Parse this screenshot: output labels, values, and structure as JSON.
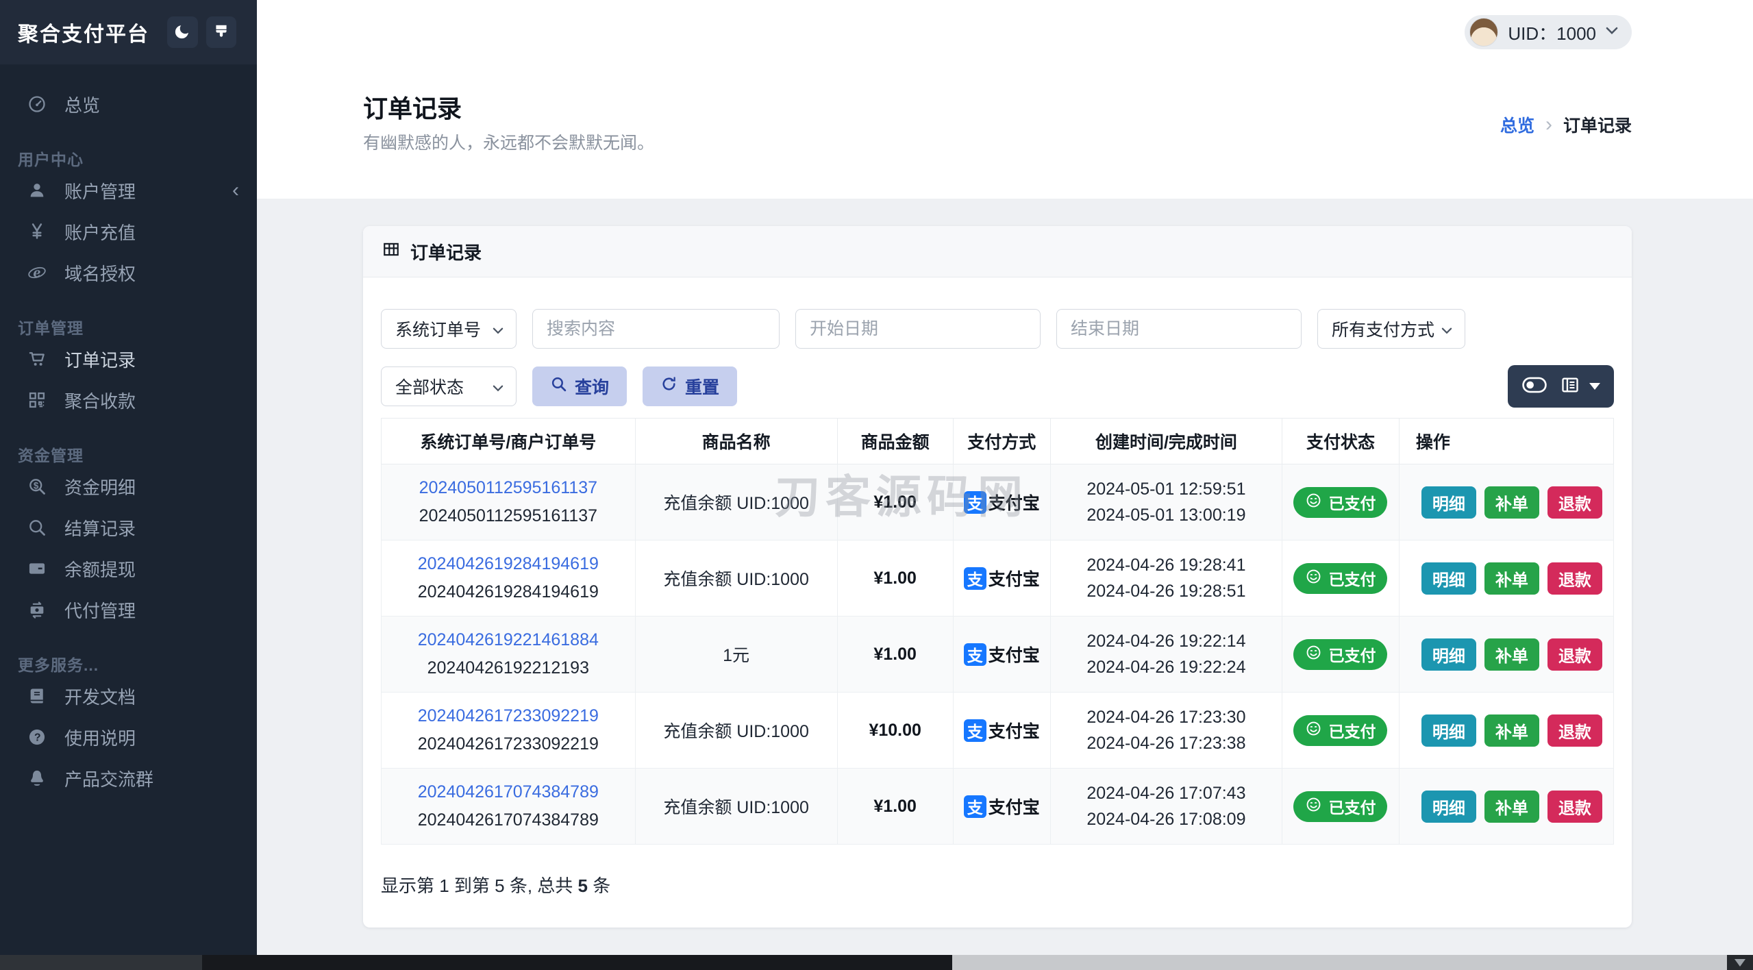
{
  "app": {
    "brand": "聚合支付平台"
  },
  "topbar": {
    "uid_label": "UID：1000"
  },
  "sidebar": {
    "sections": [
      {
        "title": "",
        "items": [
          {
            "icon": "gauge-icon",
            "name": "overview",
            "label": "总览"
          }
        ]
      },
      {
        "title": "用户中心",
        "items": [
          {
            "icon": "user-icon",
            "name": "account-management",
            "label": "账户管理",
            "trailing": "‹"
          },
          {
            "icon": "yen-icon",
            "name": "account-recharge",
            "label": "账户充值"
          },
          {
            "icon": "globe-e-icon",
            "name": "domain-authorization",
            "label": "域名授权"
          }
        ]
      },
      {
        "title": "订单管理",
        "items": [
          {
            "icon": "cart-icon",
            "name": "order-records",
            "label": "订单记录",
            "active": true
          },
          {
            "icon": "qr-icon",
            "name": "aggregate-collection",
            "label": "聚合收款"
          }
        ]
      },
      {
        "title": "资金管理",
        "items": [
          {
            "icon": "search-dollar-icon",
            "name": "fund-details",
            "label": "资金明细"
          },
          {
            "icon": "search-icon",
            "name": "settlement-records",
            "label": "结算记录"
          },
          {
            "icon": "card-icon",
            "name": "balance-withdrawal",
            "label": "余额提现"
          },
          {
            "icon": "transfer-icon",
            "name": "payout-management",
            "label": "代付管理"
          }
        ]
      },
      {
        "title": "更多服务...",
        "items": [
          {
            "icon": "book-icon",
            "name": "dev-docs",
            "label": "开发文档"
          },
          {
            "icon": "question-icon",
            "name": "usage-instructions",
            "label": "使用说明"
          },
          {
            "icon": "qq-icon",
            "name": "product-group",
            "label": "产品交流群"
          }
        ]
      }
    ]
  },
  "page": {
    "title": "订单记录",
    "subtitle": "有幽默感的人，永远都不会默默无闻。",
    "breadcrumb": {
      "home": "总览",
      "separator": "›",
      "current": "订单记录"
    }
  },
  "card": {
    "title": "订单记录"
  },
  "filters": {
    "order_no_type": "系统订单号",
    "search_placeholder": "搜索内容",
    "start_date_placeholder": "开始日期",
    "end_date_placeholder": "结束日期",
    "pay_method": "所有支付方式",
    "status": "全部状态",
    "query_label": "查询",
    "reset_label": "重置"
  },
  "table": {
    "columns": [
      "系统订单号/商户订单号",
      "商品名称",
      "商品金额",
      "支付方式",
      "创建时间/完成时间",
      "支付状态",
      "操作"
    ],
    "alipay_glyph": "支",
    "actions": [
      "明细",
      "补单",
      "退款"
    ],
    "rows": [
      {
        "sys_no": "2024050112595161137",
        "mch_no": "2024050112595161137",
        "product": "充值余额 UID:1000",
        "amount": "¥1.00",
        "method": "支付宝",
        "created": "2024-05-01 12:59:51",
        "completed": "2024-05-01 13:00:19",
        "status": "已支付"
      },
      {
        "sys_no": "2024042619284194619",
        "mch_no": "2024042619284194619",
        "product": "充值余额 UID:1000",
        "amount": "¥1.00",
        "method": "支付宝",
        "created": "2024-04-26 19:28:41",
        "completed": "2024-04-26 19:28:51",
        "status": "已支付"
      },
      {
        "sys_no": "2024042619221461884",
        "mch_no": "20240426192212193",
        "product": "1元",
        "amount": "¥1.00",
        "method": "支付宝",
        "created": "2024-04-26 19:22:14",
        "completed": "2024-04-26 19:22:24",
        "status": "已支付"
      },
      {
        "sys_no": "2024042617233092219",
        "mch_no": "2024042617233092219",
        "product": "充值余额 UID:1000",
        "amount": "¥10.00",
        "method": "支付宝",
        "created": "2024-04-26 17:23:30",
        "completed": "2024-04-26 17:23:38",
        "status": "已支付"
      },
      {
        "sys_no": "2024042617074384789",
        "mch_no": "2024042617074384789",
        "product": "充值余额 UID:1000",
        "amount": "¥1.00",
        "method": "支付宝",
        "created": "2024-04-26 17:07:43",
        "completed": "2024-04-26 17:08:09",
        "status": "已支付"
      }
    ],
    "footer": {
      "prefix": "显示第 1 到第 5 条, 总共 ",
      "count": "5",
      "suffix": " 条"
    }
  },
  "watermark": "刀客源码网",
  "colors": {
    "sidebar_bg": "#1b2431",
    "sidebar_header_bg": "#222b3a",
    "accent_blue": "#2f6bdf",
    "link_blue": "#3a6ce0",
    "soft_button_bg": "#c6cfee",
    "soft_button_text": "#27409c",
    "view_control_bg": "#2e3c52",
    "badge_green": "#20a648",
    "action_teal": "#1c96b0",
    "action_green": "#27a349",
    "action_red": "#d42a5b",
    "alipay_blue": "#1677ff"
  }
}
